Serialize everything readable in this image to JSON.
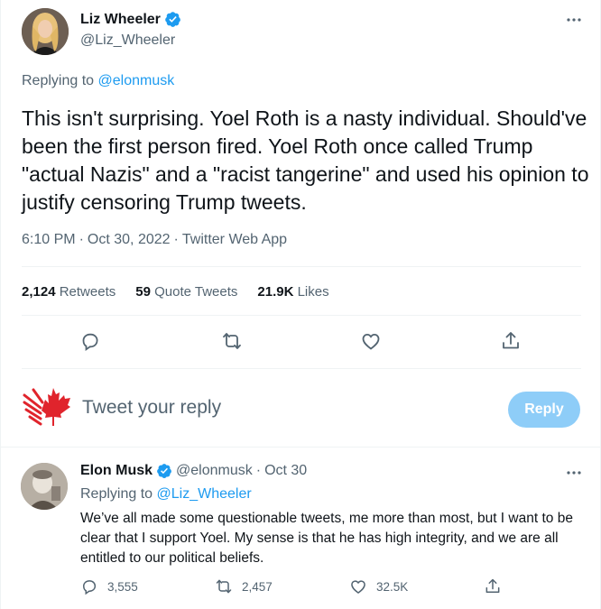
{
  "tweet": {
    "author_name": "Liz Wheeler",
    "author_handle": "@Liz_Wheeler",
    "replying_prefix": "Replying to ",
    "replying_to": "@elonmusk",
    "text": "This isn't surprising. Yoel Roth is a nasty individual. Should've been the first person fired. Yoel Roth once called Trump \"actual Nazis\" and a \"racist tangerine\" and used his opinion to justify censoring Trump tweets.",
    "time": "6:10 PM",
    "sep1": "·",
    "date": "Oct 30, 2022",
    "sep2": "·",
    "source": "Twitter Web App",
    "stats": {
      "retweets_count": "2,124",
      "retweets_label": "Retweets",
      "quotes_count": "59",
      "quotes_label": "Quote Tweets",
      "likes_count": "21.9K",
      "likes_label": "Likes"
    },
    "actions": [
      "reply-icon",
      "retweet-icon",
      "like-icon",
      "share-icon"
    ]
  },
  "composer": {
    "placeholder": "Tweet your reply",
    "button_label": "Reply",
    "avatar_icon": "maple-leaf-icon",
    "button_color": "#8ecdf8"
  },
  "reply": {
    "author_name": "Elon Musk",
    "author_handle": "@elonmusk",
    "sep": "·",
    "date": "Oct 30",
    "replying_prefix": "Replying to ",
    "replying_to": "@Liz_Wheeler",
    "text": "We’ve all made some questionable tweets, me more than most, but I want to be clear that I support Yoel. My sense is that he has high integrity, and we are all entitled to our political beliefs.",
    "reply_count": "3,555",
    "retweet_count": "2,457",
    "like_count": "32.5K"
  },
  "colors": {
    "accent": "#1d9bf0",
    "secondary_text": "#536471",
    "primary_text": "#0f1419",
    "maple_red": "#e0242c"
  }
}
